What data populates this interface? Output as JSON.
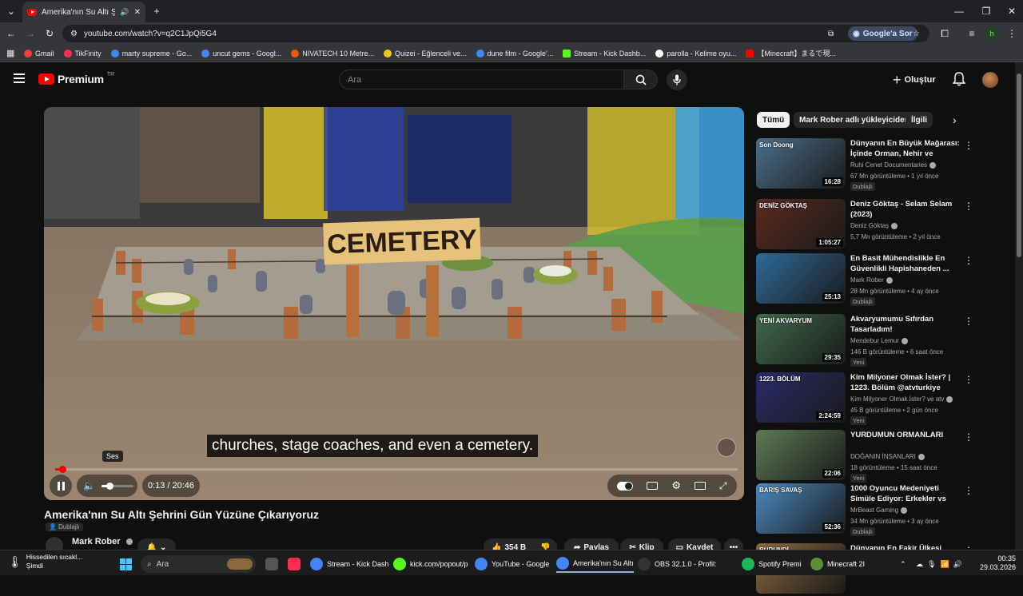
{
  "browser": {
    "tab_title": "Amerika'nın Su Altı Şehrini",
    "url": "youtube.com/watch?v=q2C1JpQi5G4",
    "google_sor": "Google'a Sor",
    "profile_initial": "h"
  },
  "bookmarks": [
    {
      "label": "Gmail",
      "color": "#ea4335"
    },
    {
      "label": "TikFinity",
      "color": "#ff2d55"
    },
    {
      "label": "marty supreme - Go...",
      "color": "#4285f4"
    },
    {
      "label": "uncut gems - Googl...",
      "color": "#4285f4"
    },
    {
      "label": "NIVATECH 10 Metre...",
      "color": "#e8590c"
    },
    {
      "label": "Quizei - Eğlenceli ve...",
      "color": "#f5c518"
    },
    {
      "label": "dune film - Google'...",
      "color": "#4285f4"
    },
    {
      "label": "Stream - Kick Dashb...",
      "color": "#53fc18"
    },
    {
      "label": "parolla - Kelime oyu...",
      "color": "#ffffff"
    },
    {
      "label": "【Minecraft】まるで現...",
      "color": "#ff0000"
    }
  ],
  "youtube": {
    "logo_text": "Premium",
    "logo_sup": "TR",
    "search_placeholder": "Ara",
    "create_label": "Oluştur"
  },
  "player": {
    "caption": "churches, stage coaches, and even a cemetery.",
    "time": "0:13 / 20:46",
    "volume_tooltip": "Ses",
    "progress_fraction": 0.0104,
    "volume_fraction": 0.25,
    "scene_sign": "CEMETERY"
  },
  "video": {
    "title": "Amerika'nın Su Altı Şehrini Gün Yüzüne Çıkarıyoruz",
    "dub_label": "Dublajlı",
    "channel": "Mark Rober",
    "likes": "354 B",
    "share_label": "Paylaş",
    "clip_label": "Klip",
    "save_label": "Kaydet"
  },
  "sidebar": {
    "chips": [
      "Tümü",
      "Mark Rober adlı yükleyiciden",
      "İlgili"
    ],
    "recommendations": [
      {
        "title": "Dünyanın En Büyük Mağarası: İçinde Orman, Nehir ve Bulutla...",
        "channel": "Ruhi Cenet Documentaries",
        "meta": "67 Mn görüntüleme • 1 yıl önce",
        "badge": "Dublajlı",
        "duration": "16:28",
        "thumb_color": "#4a6f8a",
        "thumb_text": "Son Doong"
      },
      {
        "title": "Deniz Göktaş - Selam Selam (2023)",
        "channel": "Deniz Göktaş",
        "meta": "5,7 Mn görüntüleme • 2 yıl önce",
        "badge": "",
        "duration": "1:05:27",
        "thumb_color": "#5c2a1e",
        "thumb_text": "DENİZ GÖKTAŞ"
      },
      {
        "title": "En Basit Mühendislikle En Güvenlikli Hapishaneden ...",
        "channel": "Mark Rober",
        "meta": "28 Mn görüntüleme • 4 ay önce",
        "badge": "Dublajlı",
        "duration": "25:13",
        "thumb_color": "#2f6a9a",
        "thumb_text": ""
      },
      {
        "title": "Akvaryumumu Sıfırdan Tasarladım!",
        "channel": "Mendebur Lemur",
        "meta": "146 B görüntüleme • 6 saat önce",
        "badge": "Yeni",
        "duration": "29:35",
        "thumb_color": "#3f6a4c",
        "thumb_text": "YENİ AKVARYUM"
      },
      {
        "title": "Kim Milyoner Olmak İster? | 1223. Bölüm @atvturkiye",
        "channel": "Kim Milyoner Olmak İster? ve atv",
        "meta": "45 B görüntüleme • 2 gün önce",
        "badge": "Yeni",
        "duration": "2:24:59",
        "thumb_color": "#2a2a6a",
        "thumb_text": "1223. BÖLÜM"
      },
      {
        "title": "YURDUMUN ORMANLARI",
        "channel": "DOĞANIN İNSANLARI",
        "meta": "18 görüntüleme • 15 saat önce",
        "badge": "Yeni",
        "duration": "22:06",
        "thumb_color": "#5d7a55",
        "thumb_text": ""
      },
      {
        "title": "1000 Oyuncu Medeniyeti Simüle Ediyor: Erkekler vs Kızlar",
        "channel": "MrBeast Gaming",
        "meta": "34 Mn görüntüleme • 3 ay önce",
        "badge": "Dublajlı",
        "duration": "52:36",
        "thumb_color": "#4a8ac0",
        "thumb_text": "BARIŞ SAVAŞ"
      },
      {
        "title": "Dünyanın En Fakir Ülkesi",
        "channel": "",
        "meta": "",
        "badge": "",
        "duration": "",
        "thumb_color": "#8a6a40",
        "thumb_text": "BURUNDİ"
      }
    ]
  },
  "taskbar": {
    "weather_line1": "Hissedilen sıcakl...",
    "weather_line2": "Şimdi",
    "search_placeholder": "Ara",
    "apps": [
      {
        "label": "Stream - Kick Dash",
        "color": "#4285f4"
      },
      {
        "label": "kick.com/popout/p",
        "color": "#53fc18"
      },
      {
        "label": "YouTube - Google",
        "color": "#4285f4"
      },
      {
        "label": "Amerika'nın Su Altı",
        "color": "#4285f4"
      },
      {
        "label": "OBS 32.1.0 - Profil:",
        "color": "#333333"
      },
      {
        "label": "Spotify Premi",
        "color": "#1db954"
      },
      {
        "label": "Minecraft 2I",
        "color": "#5a8f3a"
      }
    ],
    "time": "00:35",
    "date": "29.03.2026"
  }
}
